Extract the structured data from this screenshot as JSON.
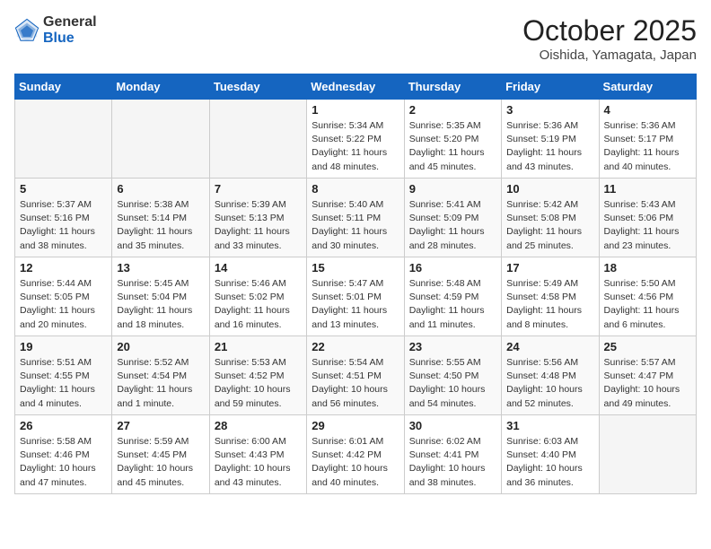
{
  "logo": {
    "general": "General",
    "blue": "Blue"
  },
  "title": "October 2025",
  "location": "Oishida, Yamagata, Japan",
  "headers": [
    "Sunday",
    "Monday",
    "Tuesday",
    "Wednesday",
    "Thursday",
    "Friday",
    "Saturday"
  ],
  "weeks": [
    [
      {
        "day": "",
        "text": "",
        "empty": true
      },
      {
        "day": "",
        "text": "",
        "empty": true
      },
      {
        "day": "",
        "text": "",
        "empty": true
      },
      {
        "day": "1",
        "text": "Sunrise: 5:34 AM\nSunset: 5:22 PM\nDaylight: 11 hours and 48 minutes.",
        "empty": false
      },
      {
        "day": "2",
        "text": "Sunrise: 5:35 AM\nSunset: 5:20 PM\nDaylight: 11 hours and 45 minutes.",
        "empty": false
      },
      {
        "day": "3",
        "text": "Sunrise: 5:36 AM\nSunset: 5:19 PM\nDaylight: 11 hours and 43 minutes.",
        "empty": false
      },
      {
        "day": "4",
        "text": "Sunrise: 5:36 AM\nSunset: 5:17 PM\nDaylight: 11 hours and 40 minutes.",
        "empty": false
      }
    ],
    [
      {
        "day": "5",
        "text": "Sunrise: 5:37 AM\nSunset: 5:16 PM\nDaylight: 11 hours and 38 minutes.",
        "empty": false
      },
      {
        "day": "6",
        "text": "Sunrise: 5:38 AM\nSunset: 5:14 PM\nDaylight: 11 hours and 35 minutes.",
        "empty": false
      },
      {
        "day": "7",
        "text": "Sunrise: 5:39 AM\nSunset: 5:13 PM\nDaylight: 11 hours and 33 minutes.",
        "empty": false
      },
      {
        "day": "8",
        "text": "Sunrise: 5:40 AM\nSunset: 5:11 PM\nDaylight: 11 hours and 30 minutes.",
        "empty": false
      },
      {
        "day": "9",
        "text": "Sunrise: 5:41 AM\nSunset: 5:09 PM\nDaylight: 11 hours and 28 minutes.",
        "empty": false
      },
      {
        "day": "10",
        "text": "Sunrise: 5:42 AM\nSunset: 5:08 PM\nDaylight: 11 hours and 25 minutes.",
        "empty": false
      },
      {
        "day": "11",
        "text": "Sunrise: 5:43 AM\nSunset: 5:06 PM\nDaylight: 11 hours and 23 minutes.",
        "empty": false
      }
    ],
    [
      {
        "day": "12",
        "text": "Sunrise: 5:44 AM\nSunset: 5:05 PM\nDaylight: 11 hours and 20 minutes.",
        "empty": false
      },
      {
        "day": "13",
        "text": "Sunrise: 5:45 AM\nSunset: 5:04 PM\nDaylight: 11 hours and 18 minutes.",
        "empty": false
      },
      {
        "day": "14",
        "text": "Sunrise: 5:46 AM\nSunset: 5:02 PM\nDaylight: 11 hours and 16 minutes.",
        "empty": false
      },
      {
        "day": "15",
        "text": "Sunrise: 5:47 AM\nSunset: 5:01 PM\nDaylight: 11 hours and 13 minutes.",
        "empty": false
      },
      {
        "day": "16",
        "text": "Sunrise: 5:48 AM\nSunset: 4:59 PM\nDaylight: 11 hours and 11 minutes.",
        "empty": false
      },
      {
        "day": "17",
        "text": "Sunrise: 5:49 AM\nSunset: 4:58 PM\nDaylight: 11 hours and 8 minutes.",
        "empty": false
      },
      {
        "day": "18",
        "text": "Sunrise: 5:50 AM\nSunset: 4:56 PM\nDaylight: 11 hours and 6 minutes.",
        "empty": false
      }
    ],
    [
      {
        "day": "19",
        "text": "Sunrise: 5:51 AM\nSunset: 4:55 PM\nDaylight: 11 hours and 4 minutes.",
        "empty": false
      },
      {
        "day": "20",
        "text": "Sunrise: 5:52 AM\nSunset: 4:54 PM\nDaylight: 11 hours and 1 minute.",
        "empty": false
      },
      {
        "day": "21",
        "text": "Sunrise: 5:53 AM\nSunset: 4:52 PM\nDaylight: 10 hours and 59 minutes.",
        "empty": false
      },
      {
        "day": "22",
        "text": "Sunrise: 5:54 AM\nSunset: 4:51 PM\nDaylight: 10 hours and 56 minutes.",
        "empty": false
      },
      {
        "day": "23",
        "text": "Sunrise: 5:55 AM\nSunset: 4:50 PM\nDaylight: 10 hours and 54 minutes.",
        "empty": false
      },
      {
        "day": "24",
        "text": "Sunrise: 5:56 AM\nSunset: 4:48 PM\nDaylight: 10 hours and 52 minutes.",
        "empty": false
      },
      {
        "day": "25",
        "text": "Sunrise: 5:57 AM\nSunset: 4:47 PM\nDaylight: 10 hours and 49 minutes.",
        "empty": false
      }
    ],
    [
      {
        "day": "26",
        "text": "Sunrise: 5:58 AM\nSunset: 4:46 PM\nDaylight: 10 hours and 47 minutes.",
        "empty": false
      },
      {
        "day": "27",
        "text": "Sunrise: 5:59 AM\nSunset: 4:45 PM\nDaylight: 10 hours and 45 minutes.",
        "empty": false
      },
      {
        "day": "28",
        "text": "Sunrise: 6:00 AM\nSunset: 4:43 PM\nDaylight: 10 hours and 43 minutes.",
        "empty": false
      },
      {
        "day": "29",
        "text": "Sunrise: 6:01 AM\nSunset: 4:42 PM\nDaylight: 10 hours and 40 minutes.",
        "empty": false
      },
      {
        "day": "30",
        "text": "Sunrise: 6:02 AM\nSunset: 4:41 PM\nDaylight: 10 hours and 38 minutes.",
        "empty": false
      },
      {
        "day": "31",
        "text": "Sunrise: 6:03 AM\nSunset: 4:40 PM\nDaylight: 10 hours and 36 minutes.",
        "empty": false
      },
      {
        "day": "",
        "text": "",
        "empty": true
      }
    ]
  ]
}
